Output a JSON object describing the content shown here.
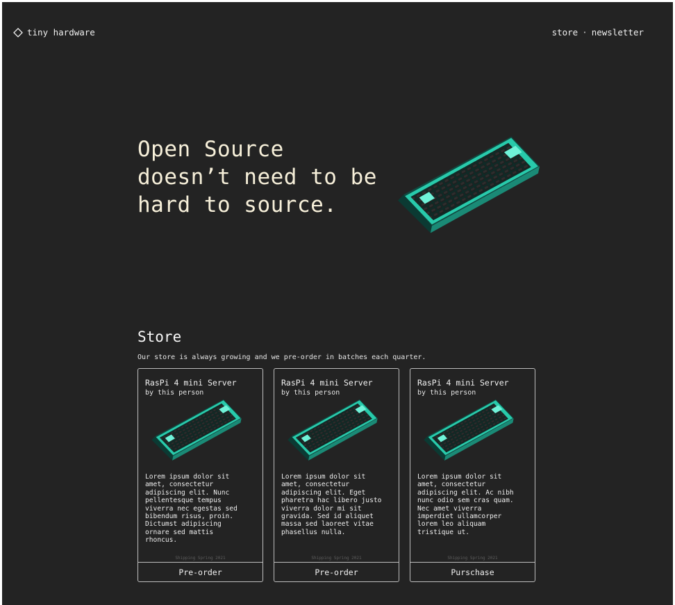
{
  "header": {
    "brand": "tiny hardware",
    "nav": {
      "store": "store",
      "separator": "·",
      "newsletter": "newsletter"
    }
  },
  "hero": {
    "lines": [
      "Open Source",
      "doesn’t need to be",
      "hard to source."
    ],
    "image_icon": "keyboard-illustration"
  },
  "store": {
    "title": "Store",
    "subtitle": "Our store is always growing and we pre-order in batches each quarter.",
    "products": [
      {
        "name": "RasPi 4 mini Server",
        "by": "by this person",
        "description": "Lorem ipsum dolor sit amet, consectetur adipiscing elit. Nunc pellentesque tempus viverra nec egestas sed bibendum risus, proin. Dictumst adipiscing ornare sed mattis rhoncus.",
        "shipping": "Shipping Spring 2021",
        "cta": "Pre-order"
      },
      {
        "name": "RasPi 4 mini Server",
        "by": "by this person",
        "description": "Lorem ipsum dolor sit amet, consectetur adipiscing elit. Eget pharetra hac libero justo viverra dolor mi sit gravida. Sed id aliquet massa sed laoreet vitae phasellus nulla.",
        "shipping": "Shipping Spring 2021",
        "cta": "Pre-order"
      },
      {
        "name": "RasPi 4 mini Server",
        "by": "by this person",
        "description": "Lorem ipsum dolor sit amet, consectetur adipiscing elit. Ac nibh nunc odio sem cras quam. Nec amet viverra imperdiet ullamcorper lorem leo aliquam tristique ut.",
        "shipping": "Shipping Spring 2021",
        "cta": "Purschase"
      }
    ]
  },
  "colors": {
    "background": "#232323",
    "accent": "#2ee6c3",
    "hero_text": "#f6efd9",
    "border": "#bfbfbf"
  }
}
